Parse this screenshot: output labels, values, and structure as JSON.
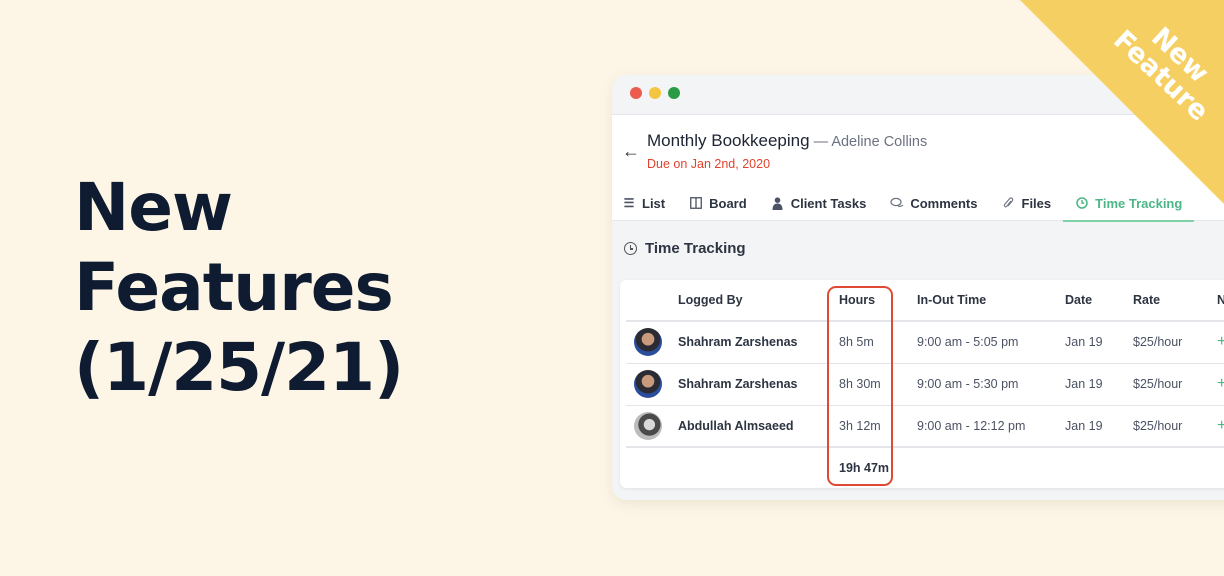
{
  "hero": {
    "line1": "New",
    "line2": "Features",
    "line3": "(1/25/21)"
  },
  "ribbon": {
    "line1": "New",
    "line2": "Feature",
    "color": "#f5cf62"
  },
  "window": {
    "task_title": "Monthly Bookkeeping",
    "separator": " — ",
    "client": "Adeline Collins",
    "due": "Due on Jan 2nd, 2020",
    "tabs": [
      {
        "label": "List",
        "icon": "list-icon"
      },
      {
        "label": "Board",
        "icon": "board-icon"
      },
      {
        "label": "Client Tasks",
        "icon": "user-icon"
      },
      {
        "label": "Comments",
        "icon": "comments-icon"
      },
      {
        "label": "Files",
        "icon": "paperclip-icon"
      },
      {
        "label": "Time Tracking",
        "icon": "clock-icon",
        "active": true
      }
    ],
    "section_title": "Time Tracking",
    "table": {
      "headers": [
        "Logged By",
        "Hours",
        "In-Out Time",
        "Date",
        "Rate",
        "No"
      ],
      "rows": [
        {
          "name": "Shahram Zarshenas",
          "hours": "8h 5m",
          "inout": "9:00 am - 5:05 pm",
          "date": "Jan 19",
          "rate": "$25/hour",
          "notes": "+"
        },
        {
          "name": "Shahram Zarshenas",
          "hours": "8h 30m",
          "inout": "9:00 am - 5:30 pm",
          "date": "Jan 19",
          "rate": "$25/hour",
          "notes": "+"
        },
        {
          "name": "Abdullah Almsaeed",
          "hours": "3h 12m",
          "inout": "9:00 am - 12:12 pm",
          "date": "Jan 19",
          "rate": "$25/hour",
          "notes": "+"
        }
      ],
      "total_hours": "19h 47m"
    }
  },
  "colors": {
    "background": "#fdf6e7",
    "accent_green": "#4cb686",
    "due_red": "#e0432c",
    "highlight_red": "#e04a32"
  }
}
